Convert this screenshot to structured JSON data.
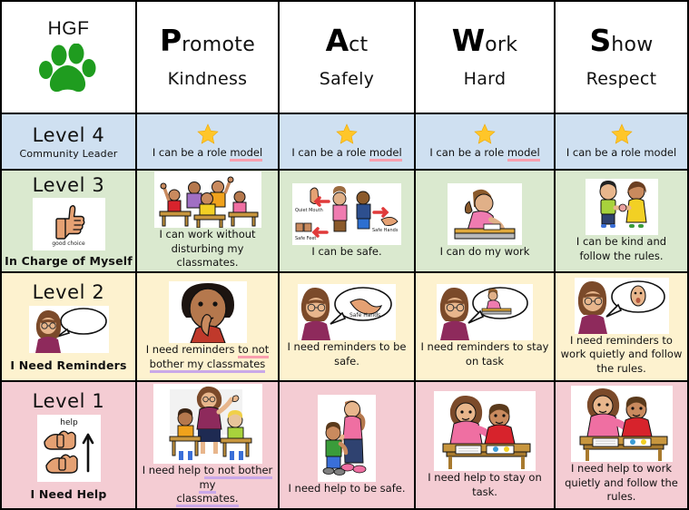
{
  "header": {
    "school_initials": "HGF",
    "logo_icon": "green-paw-print-icon",
    "columns": [
      {
        "cap": "P",
        "rest": "romote",
        "sub": "Kindness"
      },
      {
        "cap": "A",
        "rest": "ct",
        "sub": "Safely"
      },
      {
        "cap": "W",
        "rest": "ork",
        "sub": "Hard"
      },
      {
        "cap": "S",
        "rest": "how",
        "sub": "Respect"
      }
    ]
  },
  "levels": [
    {
      "title": "Level 4",
      "subtitle": "Community Leader",
      "icon": "none",
      "bg": "#cfe0f1",
      "cells": [
        {
          "icon": "gold-star-icon",
          "pre": "I can be a role ",
          "hl": "model",
          "hl_style": "u-pink",
          "post": ""
        },
        {
          "icon": "gold-star-icon",
          "pre": "I can be a role ",
          "hl": "model",
          "hl_style": "u-pink",
          "post": ""
        },
        {
          "icon": "gold-star-icon",
          "pre": "I can be a role ",
          "hl": "model",
          "hl_style": "u-pink",
          "post": ""
        },
        {
          "icon": "gold-star-icon",
          "pre": "I can be a role model",
          "hl": "",
          "hl_style": "",
          "post": ""
        }
      ]
    },
    {
      "title": "Level 3",
      "subtitle": "In Charge of Myself",
      "icon": "thumbs-up-icon",
      "icon_caption": "good choice",
      "bg": "#dae9cf",
      "cells": [
        {
          "icon": "students-raising-hands-image",
          "pre": "I can work without disturbing my classmates.",
          "hl": "",
          "hl_style": "",
          "post": ""
        },
        {
          "icon": "quiet-mouth-safe-hands-safe-feet-image",
          "pre": "I can be safe.",
          "hl": "",
          "hl_style": "",
          "post": ""
        },
        {
          "icon": "girl-writing-at-desk-image",
          "pre": "I can do my work",
          "hl": "",
          "hl_style": "",
          "post": ""
        },
        {
          "icon": "two-children-holding-hands-image",
          "pre": "I can be kind and follow the rules.",
          "hl": "",
          "hl_style": "",
          "post": ""
        }
      ]
    },
    {
      "title": "Level 2",
      "subtitle": "I Need Reminders",
      "icon": "teacher-speech-bubble-icon",
      "bg": "#fdf2cf",
      "cells": [
        {
          "icon": "child-finger-to-lips-image",
          "pre": "I need reminders ",
          "hl": "to not",
          "hl_style": "u-pink",
          "post": "bother my classmates",
          "post_style": "u-purple"
        },
        {
          "icon": "teacher-safe-hands-bubble-image",
          "pre": "I need reminders to be safe.",
          "hl": "",
          "hl_style": "",
          "post": ""
        },
        {
          "icon": "teacher-stay-on-task-bubble-image",
          "pre": "I need reminders to stay on task",
          "hl": "",
          "hl_style": "",
          "post": ""
        },
        {
          "icon": "teacher-quiet-face-bubble-image",
          "pre": "I need reminders to work quietly and follow the rules.",
          "hl": "",
          "hl_style": "",
          "post": ""
        }
      ]
    },
    {
      "title": "Level 1",
      "subtitle": "I Need Help",
      "icon": "sign-language-help-icon",
      "icon_caption": "help",
      "bg": "#f4ccd3",
      "cells": [
        {
          "icon": "teacher-helping-two-students-image",
          "pre": "I need help ",
          "hl": "to not bother my",
          "hl_style": "u-purple",
          "post": "classmates.",
          "post_style": "u-purple"
        },
        {
          "icon": "mother-and-child-walking-image",
          "pre": "I need help to be safe.",
          "hl": "",
          "hl_style": "",
          "post": ""
        },
        {
          "icon": "adult-helping-boy-at-desk-image",
          "pre": "I need help to stay on task.",
          "hl": "",
          "hl_style": "",
          "post": ""
        },
        {
          "icon": "adult-helping-boy-at-desk-image",
          "pre": "I need help to work quietly and follow the rules.",
          "hl": "",
          "hl_style": "",
          "post": ""
        }
      ]
    }
  ],
  "colors": {
    "paw_green": "#1f9c1f",
    "star_gold": "#ffc629",
    "underline_pink": "#f99fae",
    "underline_purple": "#c9a8e8",
    "border": "#000000"
  }
}
